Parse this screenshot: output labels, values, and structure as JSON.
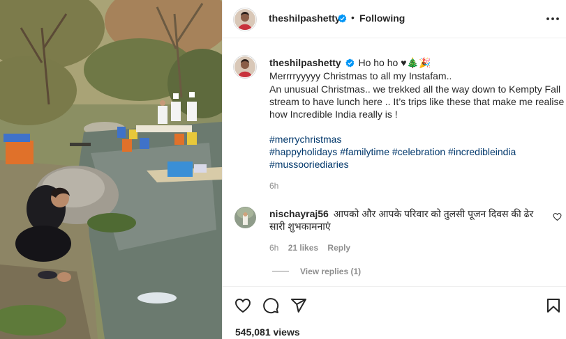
{
  "post": {
    "author": "theshilpashetty",
    "follow_state": "Following",
    "views": "545,081 views"
  },
  "caption": {
    "author": "theshilpashetty",
    "lead": "Ho ho ho ♥🎄🎉",
    "lines": [
      "Merrrryyyyy Christmas to all my Instafam..",
      "An unusual Christmas.. we trekked all the way down to Kempty Fall",
      "stream to have lunch here .. It’s trips like these that make me realise",
      "how Incredible India really is !"
    ],
    "hashtags_line1": [
      "#merrychristmas"
    ],
    "hashtags_line2": [
      "#happyholidays",
      "#familytime",
      "#celebration",
      "#incredibleindia"
    ],
    "hashtags_line3": [
      "#mussooriediaries"
    ],
    "time": "6h"
  },
  "comment": {
    "author": "nischayraj56",
    "text_line1": "आपको और आपके परिवार को तुलसी पूजन दिवस की ढेर",
    "text_line2": "सारी शुभकामनाएं",
    "time": "6h",
    "likes": "21 likes",
    "reply_label": "Reply",
    "view_replies": "View replies (1)"
  },
  "icons": {
    "verified": "verified-badge-icon",
    "more": "more-options-icon",
    "like": "heart-icon",
    "comment": "comment-bubble-icon",
    "share": "paper-plane-icon",
    "save": "bookmark-icon",
    "comment_like": "small-heart-icon"
  },
  "colors": {
    "verified": "#0095f6",
    "link": "#00376b",
    "muted": "#8e8e8e"
  }
}
